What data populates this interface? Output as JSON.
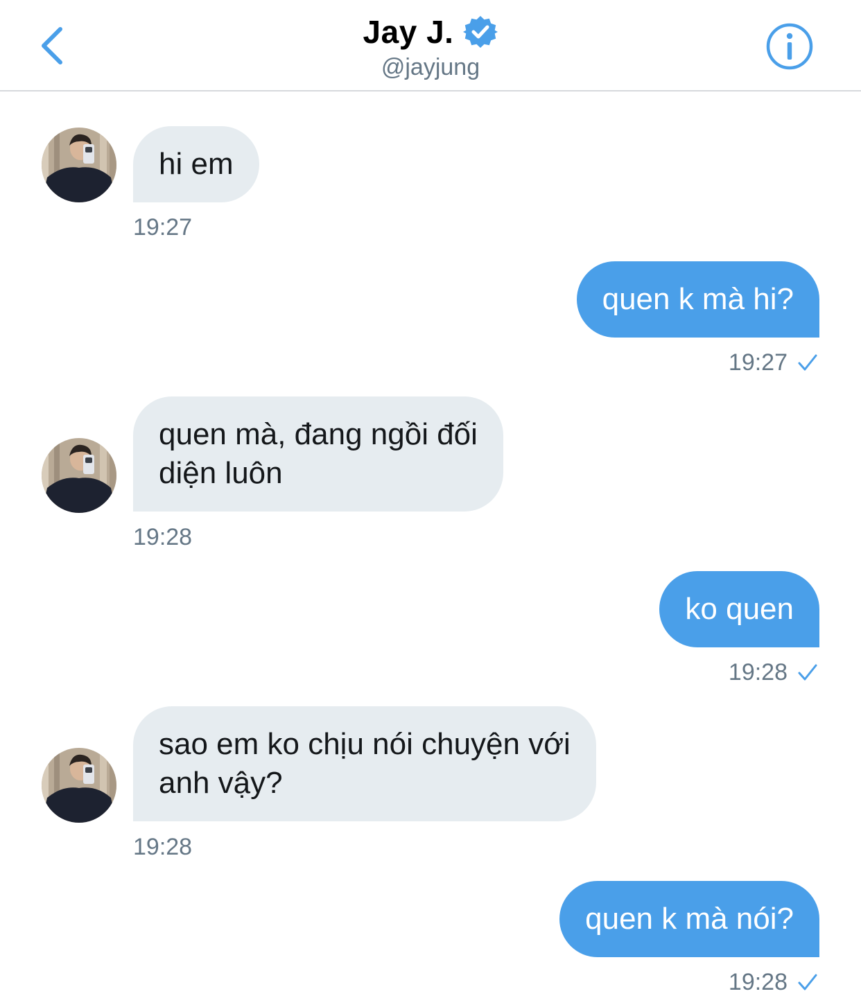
{
  "header": {
    "name": "Jay J.",
    "handle": "@jayjung",
    "back_icon": "chevron-left-icon",
    "verified_icon": "verified-badge-icon",
    "info_icon": "info-icon"
  },
  "colors": {
    "accent": "#4a9fe9",
    "incoming_bubble": "#e6ecf0",
    "timestamp": "#657786"
  },
  "messages": [
    {
      "direction": "incoming",
      "lines": [
        "hi em"
      ],
      "time": "19:27"
    },
    {
      "direction": "outgoing",
      "lines": [
        "quen k mà hi?"
      ],
      "time": "19:27",
      "status_icon": "sent-check-icon"
    },
    {
      "direction": "incoming",
      "lines": [
        "quen mà, đang ngồi đối",
        "diện luôn"
      ],
      "time": "19:28"
    },
    {
      "direction": "outgoing",
      "lines": [
        "ko quen"
      ],
      "time": "19:28",
      "status_icon": "sent-check-icon"
    },
    {
      "direction": "incoming",
      "lines": [
        "sao em ko chịu nói chuyện với",
        "anh vậy?"
      ],
      "time": "19:28"
    },
    {
      "direction": "outgoing",
      "lines": [
        "quen k mà nói?"
      ],
      "time": "19:28",
      "status_icon": "sent-check-icon"
    }
  ]
}
